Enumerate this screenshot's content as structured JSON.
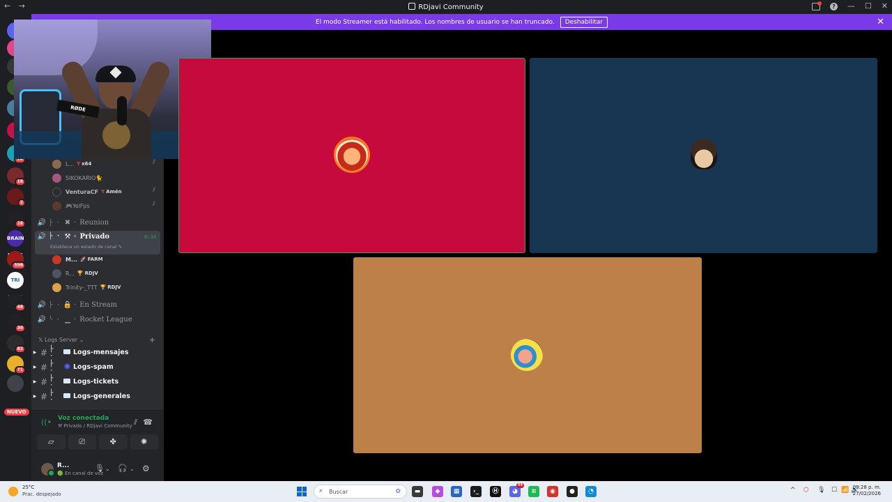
{
  "window": {
    "title": "RDjavi Community",
    "nav_back": "←",
    "nav_forward": "→",
    "minimize": "—",
    "maximize": "☐",
    "close": "✕"
  },
  "banner": {
    "message": "El modo Streamer está habilitado. Los nombres de usuario se han truncado.",
    "button": "Deshabilitar",
    "close": "✕"
  },
  "rail": {
    "servers": [
      {
        "label": "",
        "color": "#5865f2"
      },
      {
        "label": "",
        "color": "#e0488b"
      },
      {
        "label": "",
        "color": "#35373c"
      },
      {
        "label": "",
        "color": "#3a5b2f"
      },
      {
        "label": "",
        "color": "#4a7f9b"
      },
      {
        "label": "",
        "color": "#c8104d"
      },
      {
        "label": "",
        "color": "#1f9fb6",
        "ping": "1K"
      },
      {
        "label": "",
        "color": "#7a2a2a",
        "ping": "16"
      },
      {
        "label": "",
        "color": "#6b1a1a",
        "ping": "2"
      },
      {
        "label": "",
        "color": "#202124",
        "ping": "16"
      },
      {
        "label": "BRAIN HAUS",
        "color": "#4b2ca8"
      },
      {
        "label": "",
        "color": "#9b1b1b",
        "ping": "598"
      },
      {
        "label": "TRI HAUS",
        "color": "#ffffff"
      },
      {
        "label": "",
        "color": "#202124",
        "ping": "48"
      },
      {
        "label": "",
        "color": "#202124",
        "ping": "30"
      },
      {
        "label": "",
        "color": "#2c2c2c",
        "ping": "82"
      },
      {
        "label": "",
        "color": "#e6b02a",
        "ping": "71"
      },
      {
        "label": "",
        "color": "#404249"
      }
    ],
    "new_label": "NUEVO"
  },
  "voice_users_top": [
    {
      "name": "L...",
      "role_icon": "Y",
      "role": "x64",
      "avatar": "#8a6b4f",
      "muted": true
    },
    {
      "name": "SIKOKARIO🐈",
      "role_icon": "",
      "role": "",
      "avatar": "#a35a7a",
      "muted": false
    },
    {
      "name": "VenturaCF",
      "role_icon": "Y",
      "role": "Amén",
      "avatar": "#2b2d31",
      "muted": true
    },
    {
      "name": "🎮YelFps",
      "role_icon": "",
      "role": "",
      "avatar": "#5a3a2a",
      "muted": true
    }
  ],
  "voice_channels": {
    "reunion": {
      "speaker": "🔊",
      "tree": "├ ·",
      "emoji": "✖",
      "dot": "·",
      "name": "Reunion"
    },
    "privado": {
      "speaker": "🔊",
      "tree": "├ ·",
      "emoji": "⚒",
      "dot": "·",
      "name": "Privado",
      "timer": "0:33",
      "status": "Establece un estado de canal ✎"
    },
    "en_stream": {
      "speaker": "🔊",
      "tree": "├ ·",
      "emoji": "🔒",
      "dot": "·",
      "name": "En Stream"
    },
    "rocket": {
      "speaker": "🔊",
      "tree": "╰ ·",
      "emoji": "▁",
      "dot": "·",
      "name": "Rocket League"
    }
  },
  "privado_users": [
    {
      "name": "M...",
      "role_icon": "🚀",
      "role": "FARM",
      "avatar": "#c8382a"
    },
    {
      "name": "R...",
      "role_icon": "🏆",
      "role": "RDJV",
      "avatar": "#4d5562"
    },
    {
      "name": "Trinity-_TTT",
      "role_icon": "🏆",
      "role": "RDJV",
      "avatar": "#d8a34a"
    }
  ],
  "category": {
    "label": "𝕏 Logs Server ⌄",
    "add": "+"
  },
  "text_channels": [
    {
      "arrow": "▶",
      "hash": "#",
      "tree": "├ ·",
      "icon": "card",
      "name": "Logs-mensajes"
    },
    {
      "arrow": "▶",
      "hash": "#",
      "tree": "├ ·",
      "icon": "orb",
      "name": "Logs-spam"
    },
    {
      "arrow": "▶",
      "hash": "#",
      "tree": "├ ·",
      "icon": "card",
      "name": "Logs-tickets"
    },
    {
      "arrow": "▶",
      "hash": "#",
      "tree": "├ ·",
      "icon": "card",
      "name": "Logs-generales"
    }
  ],
  "voice_panel": {
    "title": "Voz conectada",
    "subtitle": "⚒ Privado / RDjavi Community",
    "signal_icon": "((•",
    "noise_icon": "⫽",
    "hangup_icon": "☎",
    "buttons": [
      "▱",
      "⎚",
      "✤",
      "✺"
    ]
  },
  "user_panel": {
    "name": "R...",
    "status": "🟢 En canal de voz",
    "mic": "🎙",
    "mic_arrow": "⌄",
    "headset": "🎧",
    "headset_arrow": "⌄",
    "settings": "⚙"
  },
  "webcam": {
    "mic_brand": "RØDE"
  },
  "taskbar": {
    "temperature": "25°C",
    "condition": "Prac. despejado",
    "search_placeholder": "Buscar",
    "apps": [
      {
        "name": "file-explorer",
        "glyph": "▬",
        "color": "#3a3a3a"
      },
      {
        "name": "copilot",
        "glyph": "◆",
        "color": "#b84be0"
      },
      {
        "name": "store",
        "glyph": "▦",
        "color": "#2a66c0"
      },
      {
        "name": "terminal",
        "glyph": "›_",
        "color": "#1b1b1b"
      },
      {
        "name": "app-h",
        "glyph": "Ⓗ",
        "color": "#111111"
      },
      {
        "name": "discord",
        "glyph": "◕",
        "color": "#5865f2",
        "badge": "99"
      },
      {
        "name": "spotify",
        "glyph": "≋",
        "color": "#1db954"
      },
      {
        "name": "chrome",
        "glyph": "◉",
        "color": "#d93025"
      },
      {
        "name": "app-red",
        "glyph": "●",
        "color": "#222222"
      },
      {
        "name": "edge",
        "glyph": "◔",
        "color": "#0f8bd8"
      }
    ],
    "tray": [
      "^",
      "⬡",
      "🎙",
      "☐",
      "📶",
      "🔊"
    ],
    "time": "09:28 p. m.",
    "date": "27/02/2026"
  }
}
